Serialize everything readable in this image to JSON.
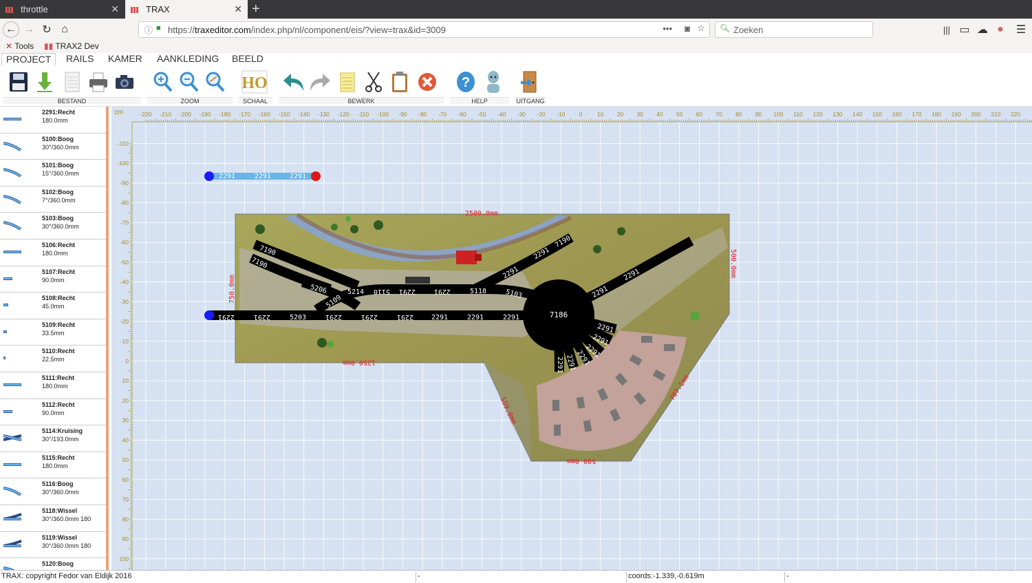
{
  "browser": {
    "tabs": [
      {
        "title": "throttle",
        "active": false
      },
      {
        "title": "TRAX",
        "active": true
      }
    ],
    "url_prefix": "https://",
    "url_domain": "traxeditor.com",
    "url_path": "/index.php/nl/component/eis/?view=trax&id=3009",
    "search_placeholder": "Zoeken",
    "bookmarks": [
      "Tools",
      "TRAX2 Dev"
    ]
  },
  "menu": {
    "items": [
      "PROJECT",
      "RAILS",
      "KAMER",
      "AANKLEDING",
      "BEELD"
    ],
    "active": "PROJECT"
  },
  "toolbar": {
    "groups": [
      "BESTAND",
      "ZOOM",
      "SCHAAL",
      "BEWERK",
      "HELP",
      "UITGANG"
    ],
    "scale_label": "HO"
  },
  "parts": [
    {
      "name": "2291:Recht",
      "dim": "180.0mm"
    },
    {
      "name": "5100:Boog",
      "dim": "30°/360.0mm"
    },
    {
      "name": "5101:Boog",
      "dim": "15°/360.0mm"
    },
    {
      "name": "5102:Boog",
      "dim": "7°/360.0mm"
    },
    {
      "name": "5103:Boog",
      "dim": "30°/360.0mm"
    },
    {
      "name": "5106:Recht",
      "dim": "180.0mm"
    },
    {
      "name": "5107:Recht",
      "dim": "90.0mm"
    },
    {
      "name": "5108:Recht",
      "dim": "45.0mm"
    },
    {
      "name": "5109:Recht",
      "dim": "33.5mm"
    },
    {
      "name": "5110:Recht",
      "dim": "22.5mm"
    },
    {
      "name": "5111:Recht",
      "dim": "180.0mm"
    },
    {
      "name": "5112:Recht",
      "dim": "90.0mm"
    },
    {
      "name": "5114:Kruising",
      "dim": "30°/193.0mm"
    },
    {
      "name": "5115:Recht",
      "dim": "180.0mm"
    },
    {
      "name": "5116:Boog",
      "dim": "30°/360.0mm"
    },
    {
      "name": "5118:Wissel",
      "dim": "30°/360.0mm 180"
    },
    {
      "name": "5119:Wissel",
      "dim": "30°/360.0mm 180"
    },
    {
      "name": "5120:Boog",
      "dim": ""
    }
  ],
  "ruler": {
    "unit": "cm",
    "x_ticks": [
      "-220",
      "-210",
      "-200",
      "-190",
      "-180",
      "-170",
      "-160",
      "-150",
      "-140",
      "-130",
      "-120",
      "-110",
      "-100",
      "-90",
      "-80",
      "-70",
      "-60",
      "-50",
      "-40",
      "-30",
      "-20",
      "-10",
      "0",
      "10",
      "20",
      "30",
      "40",
      "50",
      "60",
      "70",
      "80",
      "90",
      "100",
      "110",
      "120",
      "130",
      "140",
      "150",
      "160",
      "170",
      "180",
      "190",
      "200",
      "210",
      "220"
    ],
    "y_ticks": [
      "-110",
      "-100",
      "-90",
      "-80",
      "-70",
      "-60",
      "-50",
      "-40",
      "-30",
      "-20",
      "-10",
      "0",
      "10",
      "20",
      "30",
      "40",
      "50",
      "60",
      "70",
      "80",
      "90",
      "100"
    ]
  },
  "layout": {
    "dim_top": "2500.0mm",
    "dim_right": "500.0mm",
    "dim_left": "750.0mm",
    "dim_bottom_left": "1250.0mm",
    "dim_bottom": "500.0mm",
    "dim_diag_left": "559.0mm",
    "dim_diag_right": "707.1mm",
    "turntable": "7186",
    "loose_track_labels": [
      "2291",
      "2291",
      "2291"
    ],
    "track_labels": [
      "2291",
      "2291",
      "5203",
      "2291",
      "2291",
      "2291",
      "2291",
      "2291",
      "2291",
      "5214",
      "5118",
      "5103",
      "2291",
      "2291",
      "7190",
      "7190",
      "7190",
      "5206",
      "5110",
      "5109",
      "2291",
      "2291",
      "2291",
      "2291",
      "2291",
      "2291",
      "2291",
      "2291",
      "2291",
      "2291"
    ]
  },
  "status": {
    "copyright": "TRAX: copyright Fedor van Eldijk 2016",
    "field2": "-",
    "coords": "coords:-1.339,-0.619m",
    "field4": "-"
  }
}
